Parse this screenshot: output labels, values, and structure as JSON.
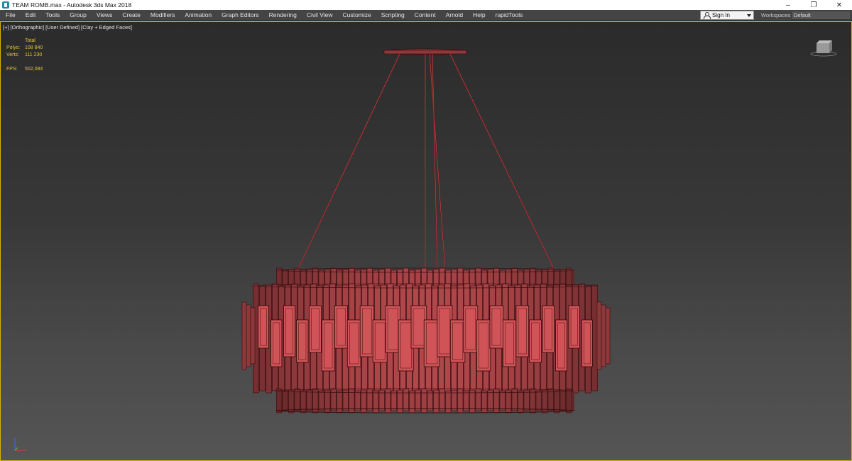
{
  "window": {
    "title": "TEAM ROMB.max - Autodesk 3ds Max 2018",
    "controls": {
      "minimize": "–",
      "restore": "❐",
      "close": "✕"
    }
  },
  "menu": [
    "File",
    "Edit",
    "Tools",
    "Group",
    "Views",
    "Create",
    "Modifiers",
    "Animation",
    "Graph Editors",
    "Rendering",
    "Civil View",
    "Customize",
    "Scripting",
    "Content",
    "Arnold",
    "Help",
    "rapidTools"
  ],
  "account": {
    "signin_label": "Sign In"
  },
  "workspace": {
    "label": "Workspaces:",
    "value": "Default"
  },
  "viewport": {
    "labels": [
      "[+]",
      "[Orthographic]",
      "[User Defined]",
      "[Clay + Edged Faces]"
    ],
    "stats": {
      "header": "Total",
      "polys_label": "Polys:",
      "polys_value": "108 840",
      "verts_label": "Verts:",
      "verts_value": "111 230",
      "fps_label": "FPS:",
      "fps_value": "502,084"
    },
    "model_color": "#b0474a",
    "border_color": "#d8b200"
  },
  "icons": [
    "app-icon",
    "user-icon",
    "chevron-down-icon",
    "viewcube-icon",
    "axis-tripod-icon"
  ]
}
